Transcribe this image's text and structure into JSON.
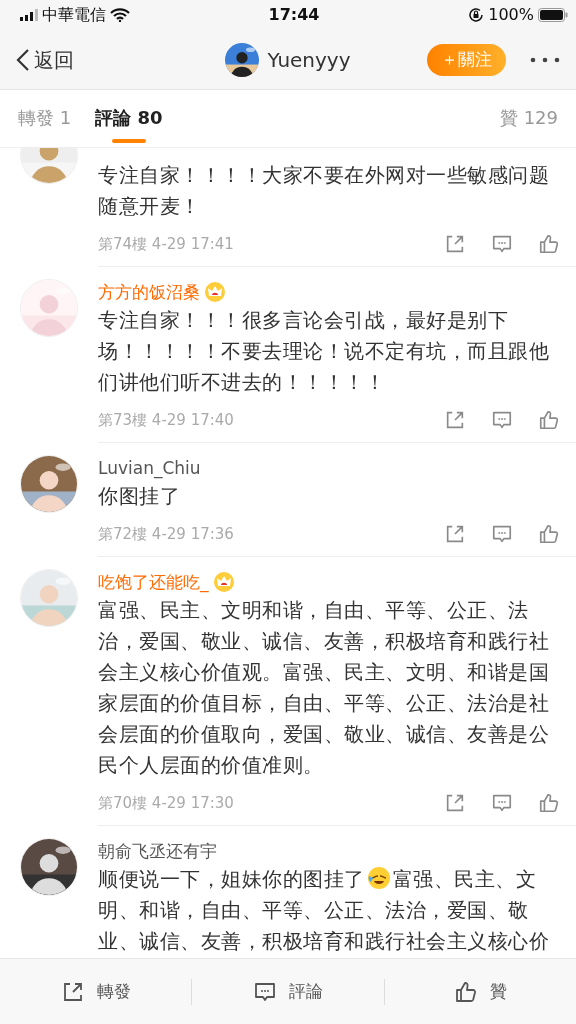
{
  "status_bar": {
    "carrier": "中華電信",
    "time": "17:44",
    "battery": "100%"
  },
  "nav": {
    "back": "返回",
    "user": "Yuenyyy",
    "follow": "＋關注"
  },
  "tabs": [
    {
      "label": "轉發 1",
      "selected": false
    },
    {
      "label": "評論 80",
      "selected": true
    },
    {
      "label": "贊 129",
      "selected": false
    }
  ],
  "comments": [
    {
      "segments": [
        {
          "kind": "text",
          "text": "专注自家！！！！大家不要在外网对一些敏感问题随意开麦！"
        }
      ],
      "meta": "第74樓 4-29 17:41"
    },
    {
      "name": "方方的饭沼桑",
      "vip": true,
      "segments": [
        {
          "kind": "text",
          "text": "专注自家！！！很多言论会引战，最好是别下场！！！！！不要去理论！说不定有坑，而且跟他们讲他们听不进去的！！！！！"
        }
      ],
      "meta": "第73樓 4-29 17:40"
    },
    {
      "name": "Luvian_Chiu",
      "vip": false,
      "segments": [
        {
          "kind": "text",
          "text": "你图挂了"
        }
      ],
      "meta": "第72樓 4-29 17:36"
    },
    {
      "name": "吃饱了还能吃_",
      "vip": true,
      "segments": [
        {
          "kind": "text",
          "text": "富强、民主、文明和谐，自由、平等、公正、法治，爱国、敬业、诚信、友善，积极培育和践行社会主义核心价值观。富强、民主、文明、和谐是国家层面的价值目标，自由、平等、公正、法治是社会层面的价值取向，爱国、敬业、诚信、友善是公民个人层面的价值准则。"
        }
      ],
      "meta": "第70樓 4-29 17:30"
    },
    {
      "name": "朝俞飞丞还有宇",
      "vip": false,
      "segments": [
        {
          "kind": "text",
          "text": "顺便说一下，姐妹你的图挂了"
        },
        {
          "kind": "emoji"
        },
        {
          "kind": "text",
          "text": "富强、民主、文明、和谐，自由、平等、公正、法治，爱国、敬业、诚信、友善，积极培育和践行社会主义核心价"
        }
      ]
    }
  ],
  "bottom_bar": [
    "轉發",
    "評論",
    "贊"
  ]
}
